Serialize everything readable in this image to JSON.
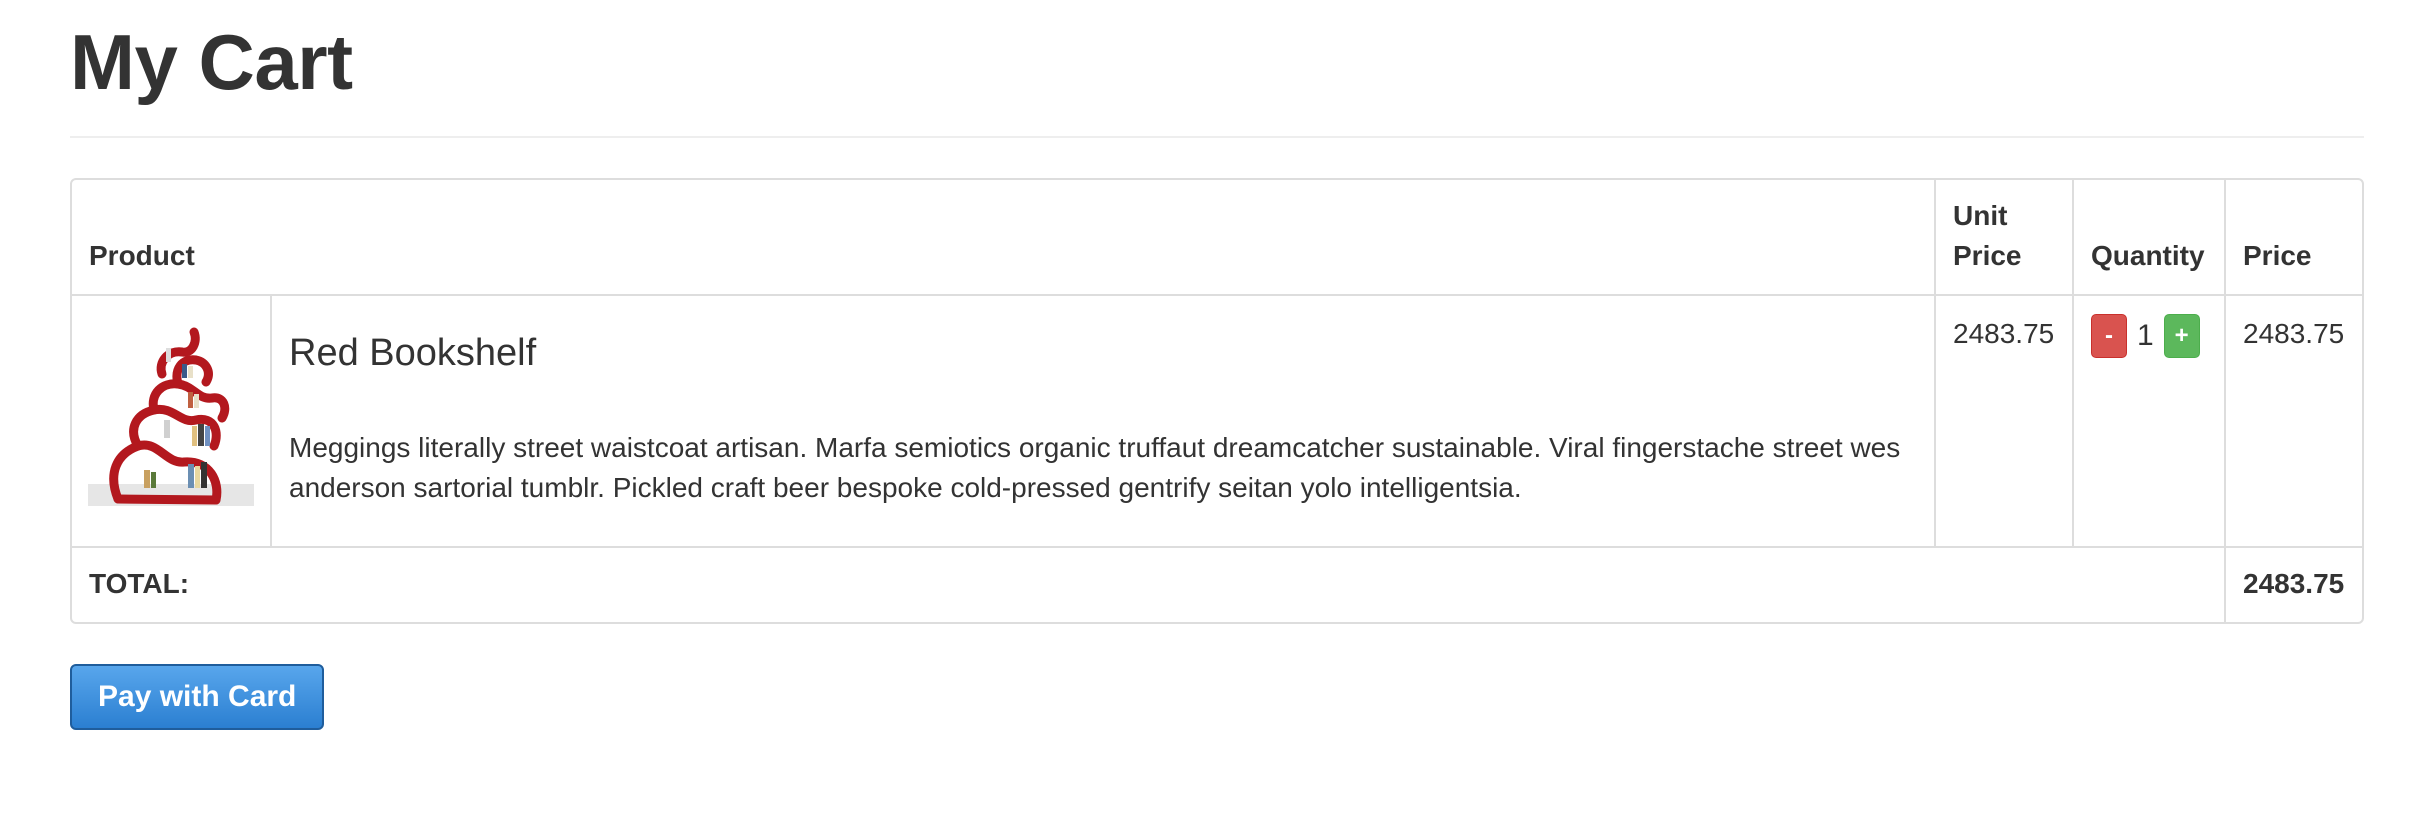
{
  "page": {
    "title": "My Cart"
  },
  "table": {
    "headers": {
      "product": "Product",
      "unit_price": "Unit Price",
      "quantity": "Quantity",
      "price": "Price"
    },
    "items": [
      {
        "name": "Red Bookshelf",
        "description": "Meggings literally street waistcoat artisan. Marfa semiotics organic truffaut dreamcatcher sustainable. Viral fingerstache street wes anderson sartorial tumblr. Pickled craft beer bespoke cold-pressed gentrify seitan yolo intelligentsia.",
        "image_icon": "red-bookshelf-image",
        "unit_price": "2483.75",
        "quantity": "1",
        "decrement_label": "-",
        "increment_label": "+",
        "price": "2483.75"
      }
    ],
    "total_label": "TOTAL:",
    "total_value": "2483.75"
  },
  "checkout": {
    "pay_label": "Pay with Card"
  },
  "colors": {
    "decrement": "#d9534f",
    "increment": "#5cb85c",
    "pay_button": "#3a8fdd",
    "border": "#dddddd"
  }
}
